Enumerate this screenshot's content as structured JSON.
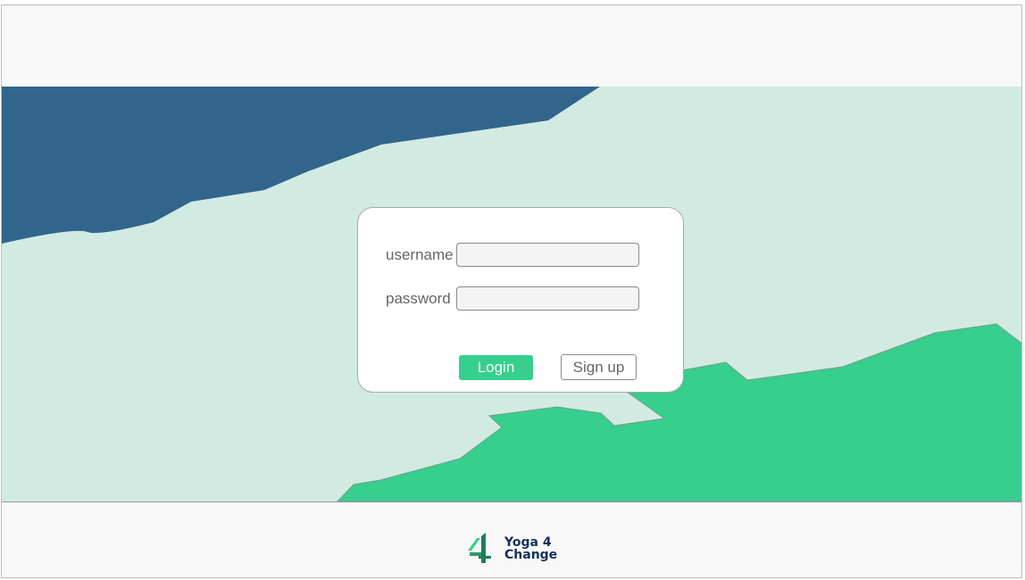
{
  "login": {
    "username_label": "username",
    "username_value": "",
    "password_label": "password",
    "password_value": "",
    "login_button": "Login",
    "signup_button": "Sign up"
  },
  "footer": {
    "brand_line1": "Yoga 4",
    "brand_line2": "Change"
  },
  "colors": {
    "background": "#f8f8f8",
    "mint": "#d2ebe2",
    "navy": "#31658c",
    "green": "#36cf8d",
    "brand_text": "#14315a"
  },
  "icons": {
    "logo": "yoga-4-change-logo-icon"
  }
}
